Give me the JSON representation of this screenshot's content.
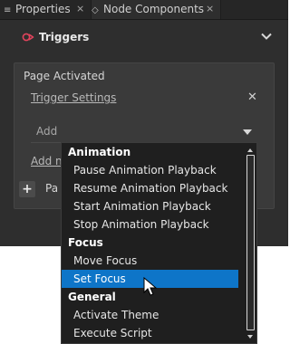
{
  "tabs": [
    {
      "label": "Properties",
      "icon": "properties-icon"
    },
    {
      "label": "Node Components",
      "icon": "node-components-icon"
    }
  ],
  "tab_close_glyph": "⨯",
  "triggers": {
    "title": "Triggers",
    "icon": "triggers-icon",
    "accent": "#e2445c"
  },
  "trigger": {
    "name": "Page Activated",
    "settings_link": "Trigger Settings",
    "add_placeholder": "Add",
    "add_node_link": "Add no",
    "page_label": "Pa",
    "plus_label": "+",
    "close_glyph": "✕"
  },
  "dropdown": {
    "groups": [
      {
        "label": "Animation",
        "items": [
          "Pause Animation Playback",
          "Resume Animation Playback",
          "Start Animation Playback",
          "Stop Animation Playback"
        ]
      },
      {
        "label": "Focus",
        "items": [
          "Move Focus",
          "Set Focus"
        ]
      },
      {
        "label": "General",
        "items": [
          "Activate Theme",
          "Execute Script"
        ]
      }
    ],
    "selected": "Set Focus",
    "selected_color": "#0e75c8"
  }
}
